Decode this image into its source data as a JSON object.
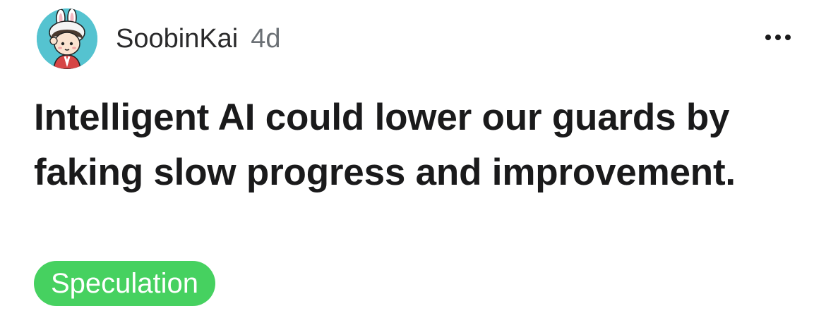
{
  "post": {
    "author": "SoobinKai",
    "age": "4d",
    "title": "Intelligent AI could lower our guards by faking slow progress and improvement.",
    "flair": {
      "label": "Speculation",
      "color": "#46d160"
    }
  },
  "avatar": {
    "icon": "bunny-hat-character-avatar",
    "background_color": "#55c3d0"
  },
  "more_menu": {
    "icon": "more-horizontal-icon"
  }
}
